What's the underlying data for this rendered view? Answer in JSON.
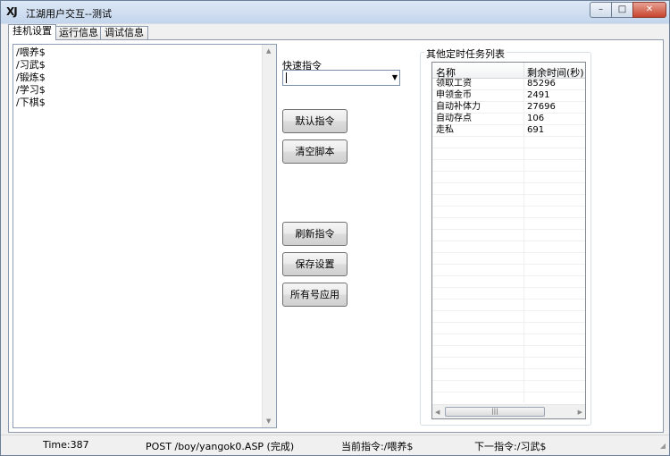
{
  "window": {
    "logo_text": "XJ",
    "title": "江湖用户交互--测试",
    "minimize_glyph": "–",
    "maximize_glyph": "□",
    "close_glyph": "✕"
  },
  "tabs": [
    {
      "label": "挂机设置",
      "active": true
    },
    {
      "label": "运行信息",
      "active": false
    },
    {
      "label": "调试信息",
      "active": false
    }
  ],
  "script_lines": [
    "/喂养$",
    "/习武$",
    "/锻炼$",
    "/学习$",
    "/下棋$"
  ],
  "quick_command": {
    "label": "快速指令",
    "value": ""
  },
  "buttons": {
    "default_cmd": "默认指令",
    "clear_script": "清空脚本",
    "refresh_cmd": "刷新指令",
    "save_settings": "保存设置",
    "apply_all": "所有号应用"
  },
  "task_group": {
    "title": "其他定时任务列表",
    "columns": [
      "名称",
      "剩余时间(秒)"
    ],
    "rows": [
      {
        "name": "领取工资",
        "remaining": "85296"
      },
      {
        "name": "申领金币",
        "remaining": "2491"
      },
      {
        "name": "自动补体力",
        "remaining": "27696"
      },
      {
        "name": "自动存点",
        "remaining": "106"
      },
      {
        "name": "走私",
        "remaining": "691"
      }
    ]
  },
  "status": {
    "time": "Time:387",
    "request": "POST /boy/yangok0.ASP (完成)",
    "current_cmd": "当前指令:/喂养$",
    "next_cmd": "下一指令:/习武$"
  }
}
